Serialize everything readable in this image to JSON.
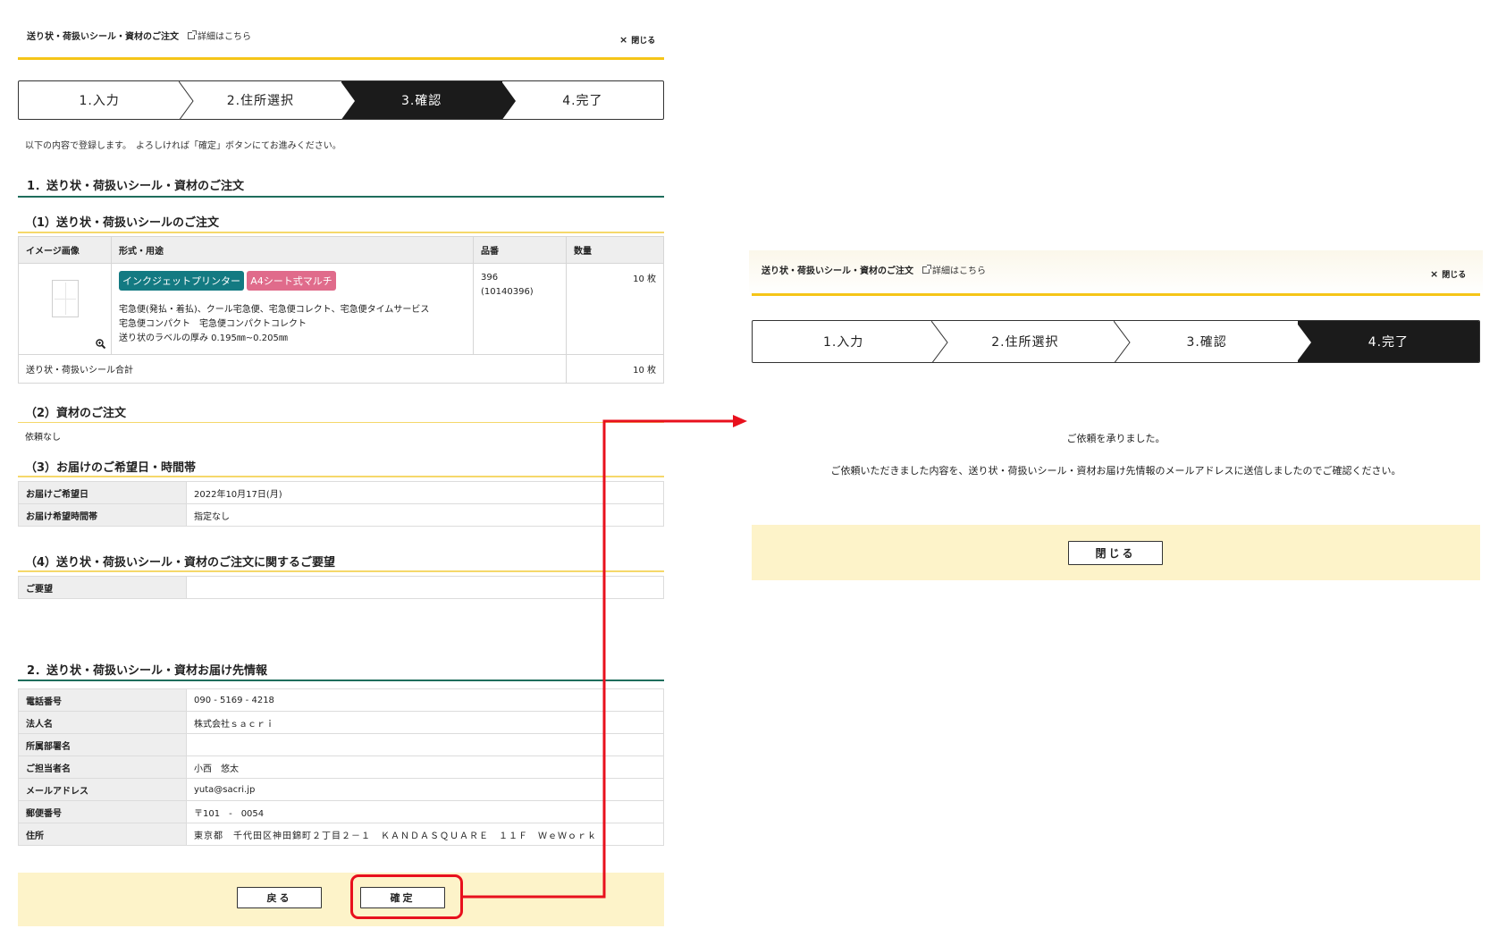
{
  "left": {
    "header": {
      "title": "送り状・荷扱いシール・資材のご注文",
      "detail_link": "詳細はこちら",
      "close": "閉じる"
    },
    "steps": [
      "1.入力",
      "2.住所選択",
      "3.確認",
      "4.完了"
    ],
    "active_step": 3,
    "lead": "以下の内容で登録します。　よろしければ「確定」ボタンにてお進みください。",
    "section1": {
      "title": "1．送り状・荷扱いシール・資材のご注文",
      "sub1": {
        "title": "（1）送り状・荷扱いシールのご注文",
        "headers": [
          "イメージ画像",
          "形式・用途",
          "品番",
          "数量"
        ],
        "tags": [
          "インクジェットプリンター",
          "A4シート式マルチ"
        ],
        "desc": [
          "宅急便(発払・着払)、クール宅急便、宅急便コレクト、宅急便タイムサービス",
          "宅急便コンパクト　宅急便コンパクトコレクト",
          "送り状のラベルの厚み 0.195㎜~0.205㎜"
        ],
        "part_no": "396",
        "part_no_sub": "(10140396)",
        "qty": "10 枚",
        "total_label": "送り状・荷扱いシール合計",
        "total_qty": "10 枚"
      },
      "sub2": {
        "title": "（2）資材のご注文",
        "value": "依頼なし"
      },
      "sub3": {
        "title": "（3）お届けのご希望日・時間帯",
        "rows": [
          {
            "k": "お届けご希望日",
            "v": "2022年10月17日(月)"
          },
          {
            "k": "お届け希望時間帯",
            "v": "指定なし"
          }
        ]
      },
      "sub4": {
        "title": "（4）送り状・荷扱いシール・資材のご注文に関するご要望",
        "rows": [
          {
            "k": "ご要望",
            "v": ""
          }
        ]
      }
    },
    "section2": {
      "title": "2．送り状・荷扱いシール・資材お届け先情報",
      "rows": [
        {
          "k": "電話番号",
          "v": "090 - 5169 - 4218"
        },
        {
          "k": "法人名",
          "v": "株式会社ｓａｃｒｉ"
        },
        {
          "k": "所属部署名",
          "v": ""
        },
        {
          "k": "ご担当者名",
          "v": "小西　悠太"
        },
        {
          "k": "メールアドレス",
          "v": "yuta@sacri.jp"
        },
        {
          "k": "郵便番号",
          "v": "〒101　-　0054"
        },
        {
          "k": "住所",
          "v": "東京都　千代田区神田錦町２丁目２－１　ＫＡＮＤＡＳＱＵＡＲＥ　１１Ｆ　ＷｅＷｏｒｋ"
        }
      ]
    },
    "buttons": {
      "back": "戻る",
      "confirm": "確定"
    }
  },
  "right": {
    "header": {
      "title": "送り状・荷扱いシール・資材のご注文",
      "detail_link": "詳細はこちら",
      "close": "閉じる"
    },
    "steps": [
      "1.入力",
      "2.住所選択",
      "3.確認",
      "4.完了"
    ],
    "active_step": 4,
    "message1": "ご依頼を承りました。",
    "message2": "ご依頼いただきました内容を、送り状・荷扱いシール・資材お届け先情報のメールアドレスに送信しましたのでご確認ください。",
    "close_button": "閉じる"
  },
  "colors": {
    "highlight": "#e8101d",
    "accent_yellow": "#f5c518",
    "section_green": "#1f6d5c"
  }
}
